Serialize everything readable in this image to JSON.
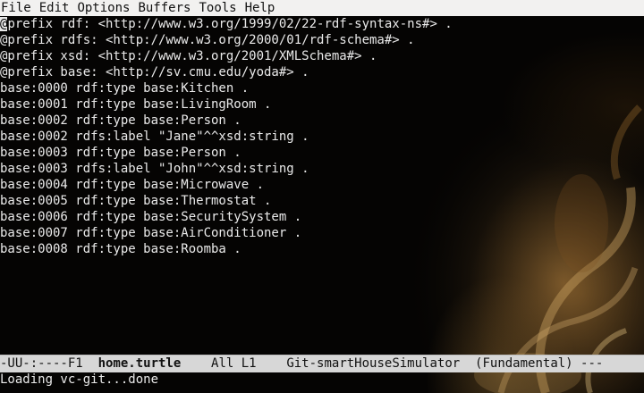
{
  "menubar": {
    "items": [
      "File",
      "Edit",
      "Options",
      "Buffers",
      "Tools",
      "Help"
    ]
  },
  "buffer": {
    "lines": [
      "@prefix rdf: <http://www.w3.org/1999/02/22-rdf-syntax-ns#> .",
      "@prefix rdfs: <http://www.w3.org/2000/01/rdf-schema#> .",
      "@prefix xsd: <http://www.w3.org/2001/XMLSchema#> .",
      "@prefix base: <http://sv.cmu.edu/yoda#> .",
      "base:0000 rdf:type base:Kitchen .",
      "base:0001 rdf:type base:LivingRoom .",
      "base:0002 rdf:type base:Person .",
      "base:0002 rdfs:label \"Jane\"^^xsd:string .",
      "base:0003 rdf:type base:Person .",
      "base:0003 rdfs:label \"John\"^^xsd:string .",
      "base:0004 rdf:type base:Microwave .",
      "base:0005 rdf:type base:Thermostat .",
      "base:0006 rdf:type base:SecuritySystem .",
      "base:0007 rdf:type base:AirConditioner .",
      "base:0008 rdf:type base:Roomba ."
    ],
    "cursor_char": "@",
    "first_line_rest": "prefix rdf: <http://www.w3.org/1999/02/22-rdf-syntax-ns#> ."
  },
  "modeline": {
    "status": "-UU-:----F1  ",
    "buffer_name": "home.turtle",
    "position": "    All L1    ",
    "vc": "Git-smartHouseSimulator  ",
    "mode": "(Fundamental) ---"
  },
  "echo": {
    "message": "Loading vc-git...done"
  },
  "colors": {
    "menubar_bg": "#f2f1f0",
    "modeline_bg": "#d7d7d7",
    "text": "#eaeaea",
    "background": "#050403"
  }
}
